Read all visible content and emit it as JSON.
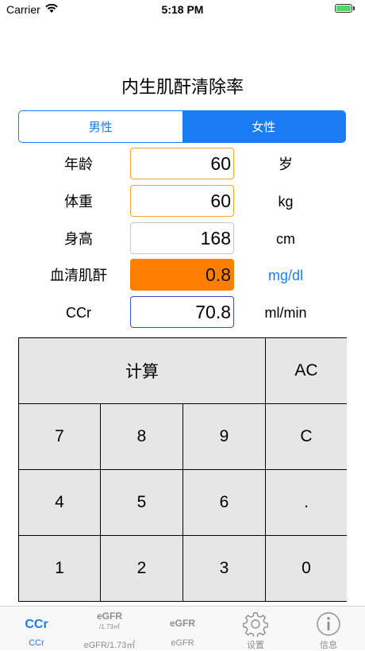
{
  "status": {
    "carrier": "Carrier",
    "time": "5:18 PM"
  },
  "title": "内生肌酐清除率",
  "segment": {
    "male": "男性",
    "female": "女性"
  },
  "rows": [
    {
      "label": "年龄",
      "value": "60",
      "unit": "岁"
    },
    {
      "label": "体重",
      "value": "60",
      "unit": "kg"
    },
    {
      "label": "身高",
      "value": "168",
      "unit": "cm"
    },
    {
      "label": "血清肌酐",
      "value": "0.8",
      "unit": "mg/dl"
    },
    {
      "label": "CCr",
      "value": "70.8",
      "unit": "ml/min"
    }
  ],
  "keypad": {
    "calc": "计算",
    "ac": "AC",
    "k7": "7",
    "k8": "8",
    "k9": "9",
    "kc": "C",
    "k4": "4",
    "k5": "5",
    "k6": "6",
    "kdot": ".",
    "k1": "1",
    "k2": "2",
    "k3": "3",
    "k0": "0"
  },
  "tabs": [
    {
      "icon": "CCr",
      "label": "CCr"
    },
    {
      "icon": "eGFR",
      "icon_sub": "/1.73㎡",
      "label": "eGFR/1.73㎡"
    },
    {
      "icon": "eGFR",
      "label": "eGFR"
    },
    {
      "icon": "gear-icon",
      "label": "设置"
    },
    {
      "icon": "info-icon",
      "label": "信息"
    }
  ],
  "colors": {
    "accent": "#1a7cf5",
    "highlight": "#ff8000"
  }
}
